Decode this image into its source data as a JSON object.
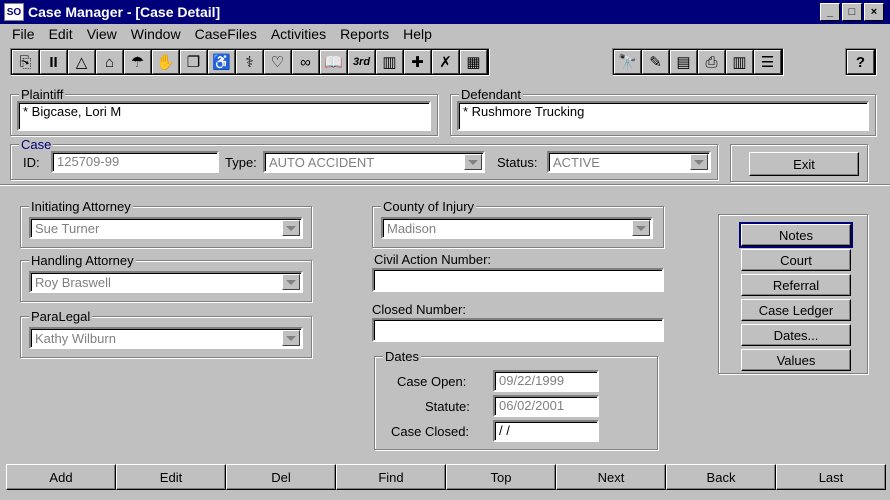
{
  "window": {
    "title": "Case Manager - [Case Detail]",
    "app_icon": "SO"
  },
  "window_controls": [
    "_",
    "□",
    "×"
  ],
  "menu": [
    "File",
    "Edit",
    "View",
    "Window",
    "CaseFiles",
    "Activities",
    "Reports",
    "Help"
  ],
  "toolbar": {
    "group1": [
      "clipboard-icon",
      "pause-icon",
      "triangle-icon",
      "house-icon",
      "graduate-icon",
      "handshake-icon",
      "copy-icon",
      "wheelchair-icon",
      "caduceus-icon",
      "heart-icon",
      "rings-icon",
      "book-icon",
      "third-icon",
      "ledger-icon",
      "medical-kit-icon",
      "crossed-hands-icon",
      "film-icon"
    ],
    "group1_glyphs": [
      "⎘",
      "II",
      "△",
      "⌂",
      "☂",
      "✋",
      "❐",
      "♿",
      "⚕",
      "♡",
      "∞",
      "📖",
      "3rd",
      "▥",
      "✚",
      "✗",
      "▦"
    ],
    "group2": [
      "binoculars-icon",
      "cards-icon",
      "calendar-icon",
      "printer-icon",
      "report-icon",
      "list-icon"
    ],
    "group2_glyphs": [
      "🔭",
      "✎",
      "▤",
      "⎙",
      "▥",
      "☰"
    ],
    "help_glyph": "?"
  },
  "plaintiff": {
    "label": "Plaintiff",
    "value": "*  Bigcase, Lori M"
  },
  "defendant": {
    "label": "Defendant",
    "value": "*  Rushmore Trucking"
  },
  "case": {
    "label": "Case",
    "id_label": "ID:",
    "id_value": "125709-99",
    "type_label": "Type:",
    "type_value": "AUTO ACCIDENT",
    "status_label": "Status:",
    "status_value": "ACTIVE"
  },
  "exit_button": "Exit",
  "initiating_attorney": {
    "label": "Initiating Attorney",
    "value": "Sue Turner"
  },
  "handling_attorney": {
    "label": "Handling Attorney",
    "value": "Roy Braswell"
  },
  "paralegal": {
    "label": "ParaLegal",
    "value": "Kathy Wilburn"
  },
  "county": {
    "label": "County of Injury",
    "value": "Madison"
  },
  "civil_action": {
    "label": "Civil Action Number:",
    "value": ""
  },
  "closed_number": {
    "label": "Closed Number:",
    "value": ""
  },
  "dates": {
    "label": "Dates",
    "case_open_label": "Case Open:",
    "case_open": "09/22/1999",
    "statute_label": "Statute:",
    "statute": "06/02/2001",
    "case_closed_label": "Case Closed:",
    "case_closed": " /  /"
  },
  "side_buttons": [
    "Notes",
    "Court",
    "Referral",
    "Case Ledger",
    "Dates...",
    "Values"
  ],
  "nav_buttons": [
    "Add",
    "Edit",
    "Del",
    "Find",
    "Top",
    "Next",
    "Back",
    "Last"
  ],
  "colors": {
    "titlebar": "#00007b",
    "face": "#c0c0c0",
    "disabled_text": "#808080"
  }
}
